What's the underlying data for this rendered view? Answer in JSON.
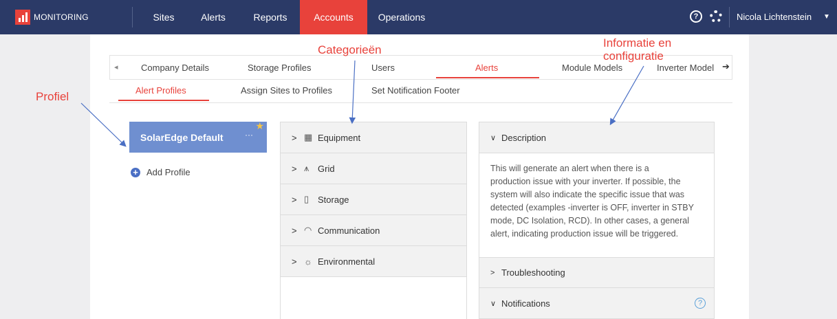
{
  "topbar": {
    "logo": "MONITORING",
    "nav": [
      "Sites",
      "Alerts",
      "Reports",
      "Accounts",
      "Operations"
    ],
    "active_nav": "Accounts",
    "user": "Nicola Lichtenstein",
    "help_glyph": "?",
    "accent": "#e8423b",
    "bg": "#2b3a67"
  },
  "tabs": {
    "primary": [
      "Company Details",
      "Storage Profiles",
      "Users",
      "Alerts",
      "Module Models",
      "Inverter Model"
    ],
    "primary_active": "Alerts",
    "secondary": [
      "Alert Profiles",
      "Assign Sites to Profiles",
      "Set Notification Footer"
    ],
    "secondary_active": "Alert Profiles"
  },
  "profiles": {
    "selected": "SolarEdge Default",
    "menu_glyph": "···",
    "add_label": "Add Profile"
  },
  "categories": [
    {
      "label": "Equipment",
      "icon": "equipment-icon"
    },
    {
      "label": "Grid",
      "icon": "grid-tower-icon"
    },
    {
      "label": "Storage",
      "icon": "battery-icon"
    },
    {
      "label": "Communication",
      "icon": "wifi-icon"
    },
    {
      "label": "Environmental",
      "icon": "weather-icon"
    }
  ],
  "info": {
    "description_title": "Description",
    "description_lines": [
      "This will generate an alert when there is a",
      "production issue with your inverter. If possible, the",
      "system will also indicate the specific issue that was",
      "detected (examples -inverter is OFF, inverter in STBY",
      "mode, DC Isolation, RCD). In other cases, a general",
      "alert, indicating production issue will be triggered."
    ],
    "troubleshooting_title": "Troubleshooting",
    "notifications_title": "Notifications"
  },
  "annotations": {
    "profile": "Profiel",
    "categories": "Categorieën",
    "info_line1": "Informatie en",
    "info_line2": "configuratie"
  }
}
